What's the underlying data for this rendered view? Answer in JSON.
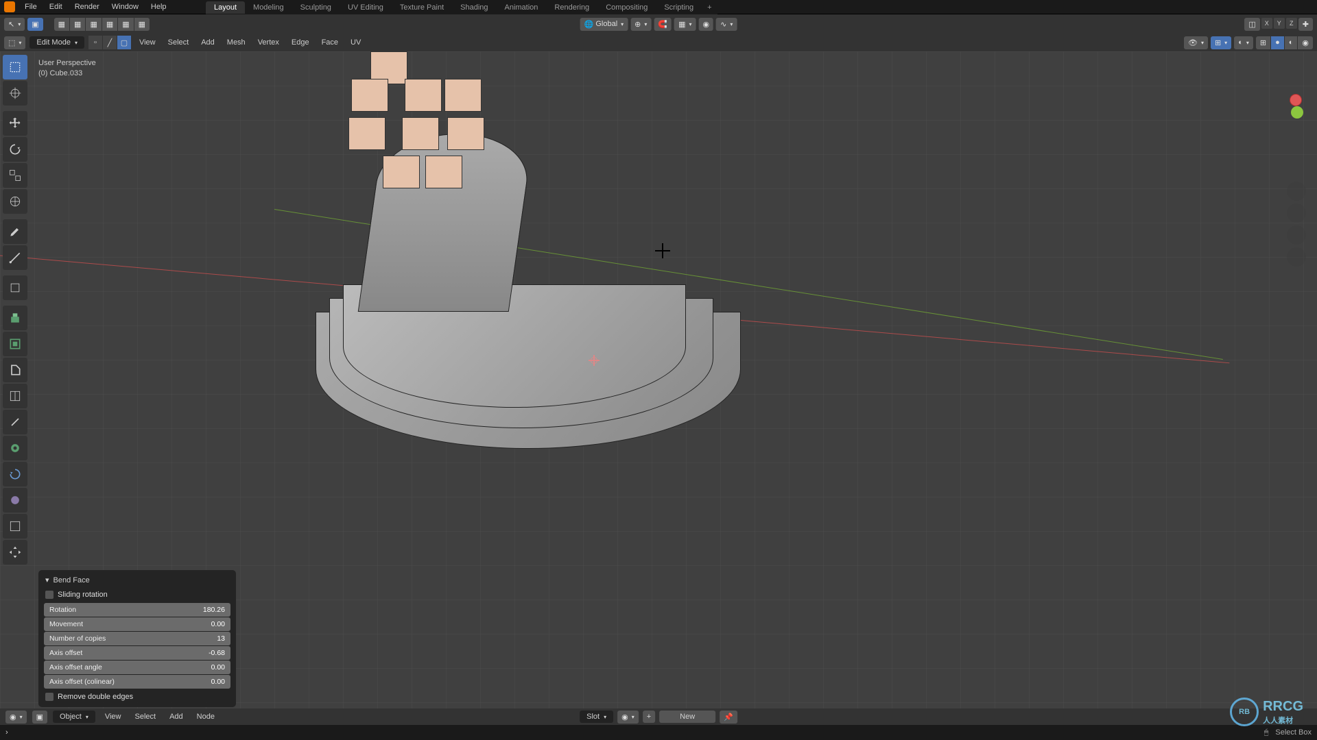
{
  "top_menu": {
    "file": "File",
    "edit": "Edit",
    "render": "Render",
    "window": "Window",
    "help": "Help"
  },
  "workspace_tabs": {
    "layout": "Layout",
    "modeling": "Modeling",
    "sculpting": "Sculpting",
    "uv_editing": "UV Editing",
    "texture_paint": "Texture Paint",
    "shading": "Shading",
    "animation": "Animation",
    "rendering": "Rendering",
    "compositing": "Compositing",
    "scripting": "Scripting"
  },
  "toolbar2": {
    "orientation": "Global",
    "axes": {
      "x": "X",
      "y": "Y",
      "z": "Z"
    }
  },
  "toolbar3": {
    "mode": "Edit Mode",
    "menus": {
      "view": "View",
      "select": "Select",
      "add": "Add",
      "mesh": "Mesh",
      "vertex": "Vertex",
      "edge": "Edge",
      "face": "Face",
      "uv": "UV"
    }
  },
  "viewport": {
    "perspective": "User Perspective",
    "object": "(0) Cube.033"
  },
  "operator": {
    "title": "Bend Face",
    "sliding_rotation_label": "Sliding rotation",
    "rotation_label": "Rotation",
    "rotation_value": "180.26",
    "movement_label": "Movement",
    "movement_value": "0.00",
    "copies_label": "Number of copies",
    "copies_value": "13",
    "axis_offset_label": "Axis offset",
    "axis_offset_value": "-0.68",
    "axis_angle_label": "Axis offset angle",
    "axis_angle_value": "0.00",
    "axis_colinear_label": "Axis offset (colinear)",
    "axis_colinear_value": "0.00",
    "remove_double_label": "Remove double edges"
  },
  "bottom_bar": {
    "object_dd": "Object",
    "view": "View",
    "select": "Select",
    "add": "Add",
    "node": "Node",
    "slot": "Slot",
    "new": "New"
  },
  "status": {
    "select_box": "Select Box"
  },
  "watermark": {
    "text": "RRCG",
    "sub": "人人素材"
  }
}
